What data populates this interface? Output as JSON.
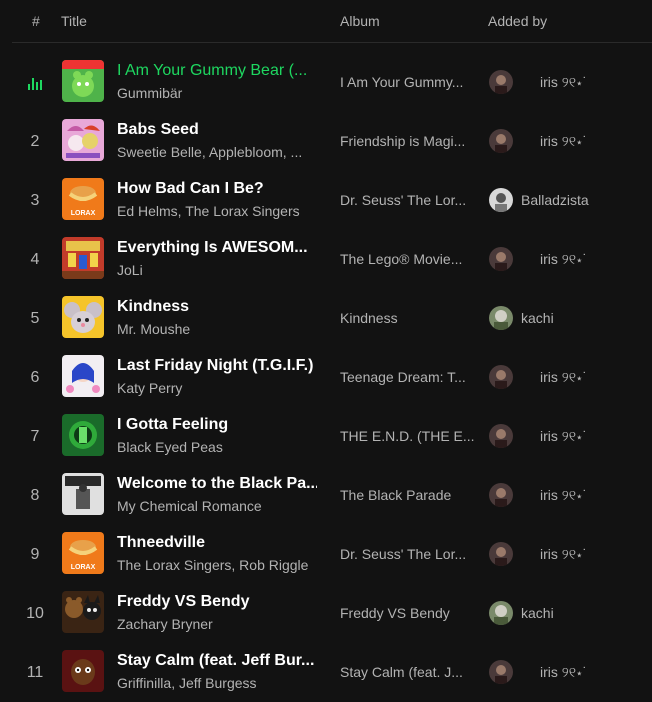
{
  "header": {
    "number": "#",
    "title": "Title",
    "album": "Album",
    "added_by": "Added by"
  },
  "tracks": [
    {
      "number": "1",
      "title": "I Am Your Gummy Bear (...",
      "artist": "Gummibär",
      "album": "I Am Your Gummy...",
      "added_by": "iris ୨୧⋆˙",
      "playing": true,
      "art_color": "#4fb34a",
      "art_icon": "gummy-bear-art"
    },
    {
      "number": "2",
      "title": "Babs Seed",
      "artist": "Sweetie Belle, Applebloom, ...",
      "album": "Friendship is Magi...",
      "added_by": "iris ୨୧⋆˙",
      "art_color": "#e8a8d8",
      "art_icon": "pony-art"
    },
    {
      "number": "3",
      "title": "How Bad Can I Be?",
      "artist": "Ed Helms, The Lorax Singers",
      "album": "Dr. Seuss' The Lor...",
      "added_by": "Balladzista",
      "art_color": "#f07a1a",
      "art_icon": "lorax-art"
    },
    {
      "number": "4",
      "title": "Everything Is AWESOM...",
      "artist": "JoLi",
      "album": "The Lego® Movie...",
      "added_by": "iris ୨୧⋆˙",
      "art_color": "#c23b2a",
      "art_icon": "lego-movie-art"
    },
    {
      "number": "5",
      "title": "Kindness",
      "artist": "Mr. Moushe",
      "album": "Kindness",
      "added_by": "kachi",
      "art_color": "#f5c42a",
      "art_icon": "mouse-art"
    },
    {
      "number": "6",
      "title": "Last Friday Night (T.G.I.F.)",
      "artist": "Katy Perry",
      "album": "Teenage Dream: T...",
      "added_by": "iris ୨୧⋆˙",
      "art_color": "#f2eef2",
      "art_icon": "teenage-dream-art"
    },
    {
      "number": "7",
      "title": "I Gotta Feeling",
      "artist": "Black Eyed Peas",
      "album": "THE E.N.D. (THE E...",
      "added_by": "iris ୨୧⋆˙",
      "art_color": "#1a6b2a",
      "art_icon": "the-end-art"
    },
    {
      "number": "8",
      "title": "Welcome to the Black Pa...",
      "artist": "My Chemical Romance",
      "album": "The Black Parade",
      "added_by": "iris ୨୧⋆˙",
      "art_color": "#e0e0e0",
      "art_icon": "black-parade-art"
    },
    {
      "number": "9",
      "title": "Thneedville",
      "artist": "The Lorax Singers, Rob Riggle",
      "album": "Dr. Seuss' The Lor...",
      "added_by": "iris ୨୧⋆˙",
      "art_color": "#f07a1a",
      "art_icon": "lorax-art"
    },
    {
      "number": "10",
      "title": "Freddy VS Bendy",
      "artist": "Zachary Bryner",
      "album": "Freddy VS Bendy",
      "added_by": "kachi",
      "art_color": "#3a2414",
      "art_icon": "freddy-vs-bendy-art"
    },
    {
      "number": "11",
      "title": "Stay Calm (feat. Jeff Bur...",
      "artist": "Griffinilla, Jeff Burgess",
      "album": "Stay Calm (feat. J...",
      "added_by": "iris ୨୧⋆˙",
      "art_color": "#5a1212",
      "art_icon": "stay-calm-art"
    }
  ],
  "lorax_label": "LORAX",
  "accent_color": "#1ed760",
  "icons": {
    "playing": "equalizer-icon"
  }
}
